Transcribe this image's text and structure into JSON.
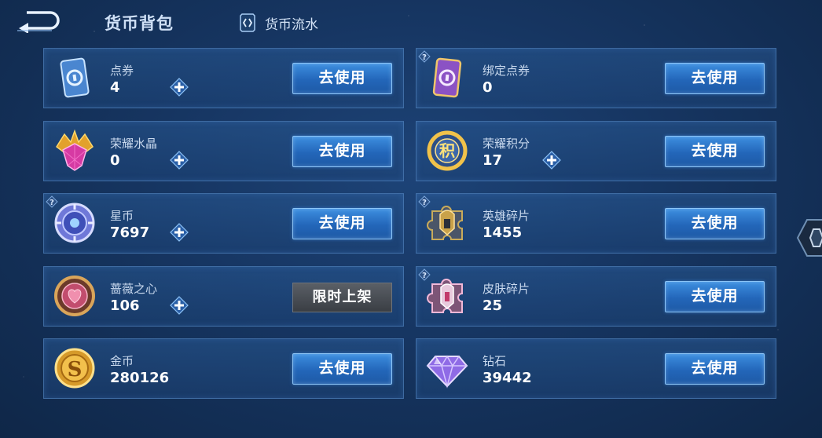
{
  "header": {
    "title": "货币背包",
    "flow_tab_label": "货币流水"
  },
  "colors": {
    "use_button": "#2a71c4",
    "limited_button": "#464a50",
    "card_border": "#5d91cd"
  },
  "currencies": [
    {
      "name": "点券",
      "amount": "4",
      "has_plus": true,
      "has_help": false,
      "button": "去使用",
      "icon": "coupon-card-icon"
    },
    {
      "name": "绑定点券",
      "amount": "0",
      "has_plus": false,
      "has_help": true,
      "button": "去使用",
      "icon": "bound-coupon-card-icon"
    },
    {
      "name": "荣耀水晶",
      "amount": "0",
      "has_plus": true,
      "has_help": false,
      "button": "去使用",
      "icon": "glory-crystal-icon"
    },
    {
      "name": "荣耀积分",
      "amount": "17",
      "has_plus": true,
      "has_help": false,
      "button": "去使用",
      "icon": "glory-points-coin-icon"
    },
    {
      "name": "星币",
      "amount": "7697",
      "has_plus": true,
      "has_help": true,
      "button": "去使用",
      "icon": "star-coin-icon"
    },
    {
      "name": "英雄碎片",
      "amount": "1455",
      "has_plus": false,
      "has_help": true,
      "button": "去使用",
      "icon": "hero-fragment-icon"
    },
    {
      "name": "蔷薇之心",
      "amount": "106",
      "has_plus": true,
      "has_help": false,
      "button": "限时上架",
      "icon": "rose-heart-icon"
    },
    {
      "name": "皮肤碎片",
      "amount": "25",
      "has_plus": false,
      "has_help": true,
      "button": "去使用",
      "icon": "skin-fragment-icon"
    },
    {
      "name": "金币",
      "amount": "280126",
      "has_plus": false,
      "has_help": false,
      "button": "去使用",
      "icon": "gold-coin-icon"
    },
    {
      "name": "钻石",
      "amount": "39442",
      "has_plus": false,
      "has_help": false,
      "button": "去使用",
      "icon": "diamond-icon"
    }
  ]
}
